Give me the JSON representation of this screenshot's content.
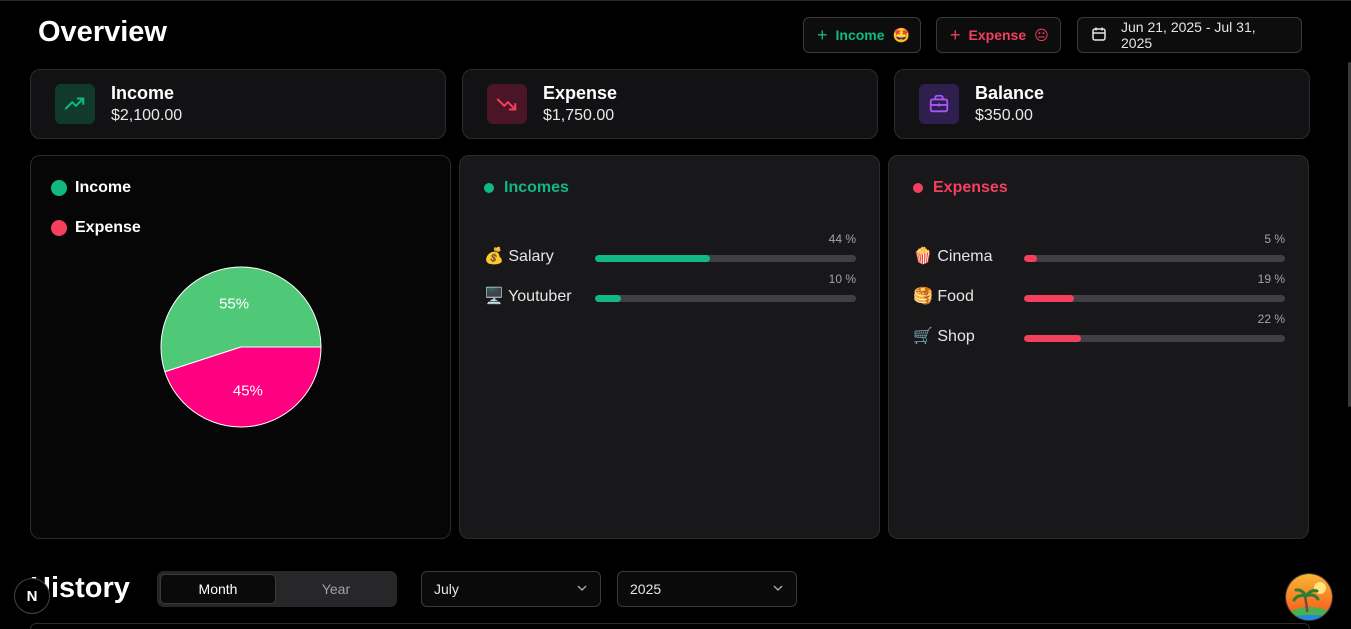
{
  "header": {
    "title": "Overview",
    "add_income": {
      "label": "Income",
      "emoji": "🤩"
    },
    "add_expense": {
      "label": "Expense",
      "emoji": "😐"
    },
    "date_range": "Jun 21, 2025 - Jul 31, 2025"
  },
  "stats": [
    {
      "label": "Income",
      "value": "$2,100.00",
      "icon": "trending-up-icon",
      "color": "#10b981"
    },
    {
      "label": "Expense",
      "value": "$1,750.00",
      "icon": "trending-down-icon",
      "color": "#f43f5e"
    },
    {
      "label": "Balance",
      "value": "$350.00",
      "icon": "wallet-icon",
      "color": "#a855f7"
    }
  ],
  "chart_data": {
    "type": "pie",
    "legend": [
      {
        "name": "Income",
        "color": "#10b981"
      },
      {
        "name": "Expense",
        "color": "#f43f5e"
      }
    ],
    "slices": [
      {
        "name": "Income",
        "value": 55,
        "label": "55%",
        "color": "#4fc978"
      },
      {
        "name": "Expense",
        "value": 45,
        "label": "45%",
        "color": "#ff0080"
      }
    ]
  },
  "incomes": {
    "title": "Incomes",
    "color": "#10b981",
    "items": [
      {
        "emoji": "💰",
        "name": "Salary",
        "percent": 44,
        "label": "44 %"
      },
      {
        "emoji": "🖥️",
        "name": "Youtuber",
        "percent": 10,
        "label": "10 %"
      }
    ]
  },
  "expenses": {
    "title": "Expenses",
    "color": "#f43f5e",
    "items": [
      {
        "emoji": "🍿",
        "name": "Cinema",
        "percent": 5,
        "label": "5 %"
      },
      {
        "emoji": "🥞",
        "name": "Food",
        "percent": 19,
        "label": "19 %"
      },
      {
        "emoji": "🛒",
        "name": "Shop",
        "percent": 22,
        "label": "22 %"
      }
    ]
  },
  "history": {
    "title": "History",
    "tabs": [
      "Month",
      "Year"
    ],
    "active_tab": "Month",
    "month": "July",
    "year": "2025"
  },
  "badge": "N"
}
